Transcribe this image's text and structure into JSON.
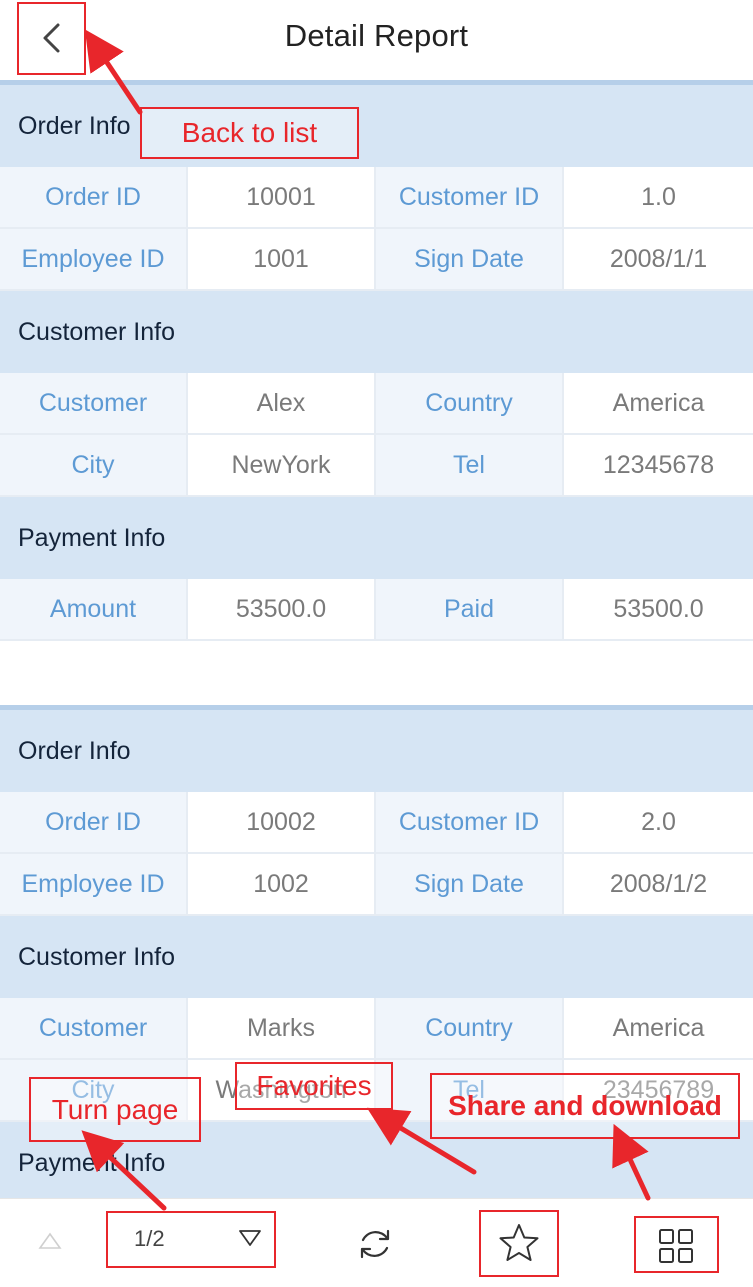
{
  "header": {
    "title": "Detail Report"
  },
  "records": [
    {
      "order": {
        "title": "Order Info",
        "rows": [
          [
            "Order ID",
            "10001",
            "Customer ID",
            "1.0"
          ],
          [
            "Employee ID",
            "1001",
            "Sign Date",
            "2008/1/1"
          ]
        ]
      },
      "customer": {
        "title": "Customer Info",
        "rows": [
          [
            "Customer",
            "Alex",
            "Country",
            "America"
          ],
          [
            "City",
            "NewYork",
            "Tel",
            "12345678"
          ]
        ]
      },
      "payment": {
        "title": "Payment Info",
        "rows": [
          [
            "Amount",
            "53500.0",
            "Paid",
            "53500.0"
          ]
        ]
      }
    },
    {
      "order": {
        "title": "Order Info",
        "rows": [
          [
            "Order ID",
            "10002",
            "Customer ID",
            "2.0"
          ],
          [
            "Employee ID",
            "1002",
            "Sign Date",
            "2008/1/2"
          ]
        ]
      },
      "customer": {
        "title": "Customer Info",
        "rows": [
          [
            "Customer",
            "Marks",
            "Country",
            "America"
          ],
          [
            "City",
            "Washington",
            "Tel",
            "23456789"
          ]
        ]
      },
      "payment": {
        "title": "Payment Info",
        "rows": []
      }
    }
  ],
  "footer": {
    "page_indicator": "1/2",
    "icons": {
      "prev": "triangle-up-icon",
      "dropdown": "triangle-down-icon",
      "refresh": "refresh-icon",
      "favorite": "star-icon",
      "share": "grid-icon"
    }
  },
  "annotations": {
    "back": "Back to list",
    "turn_page": "Turn page",
    "favorites": "Favorites",
    "share": "Share and download"
  },
  "colors": {
    "annotation": "#e8262b",
    "section_bg": "#d6e5f4",
    "label_text": "#5d9ad4",
    "value_text": "#7a7a7a"
  }
}
